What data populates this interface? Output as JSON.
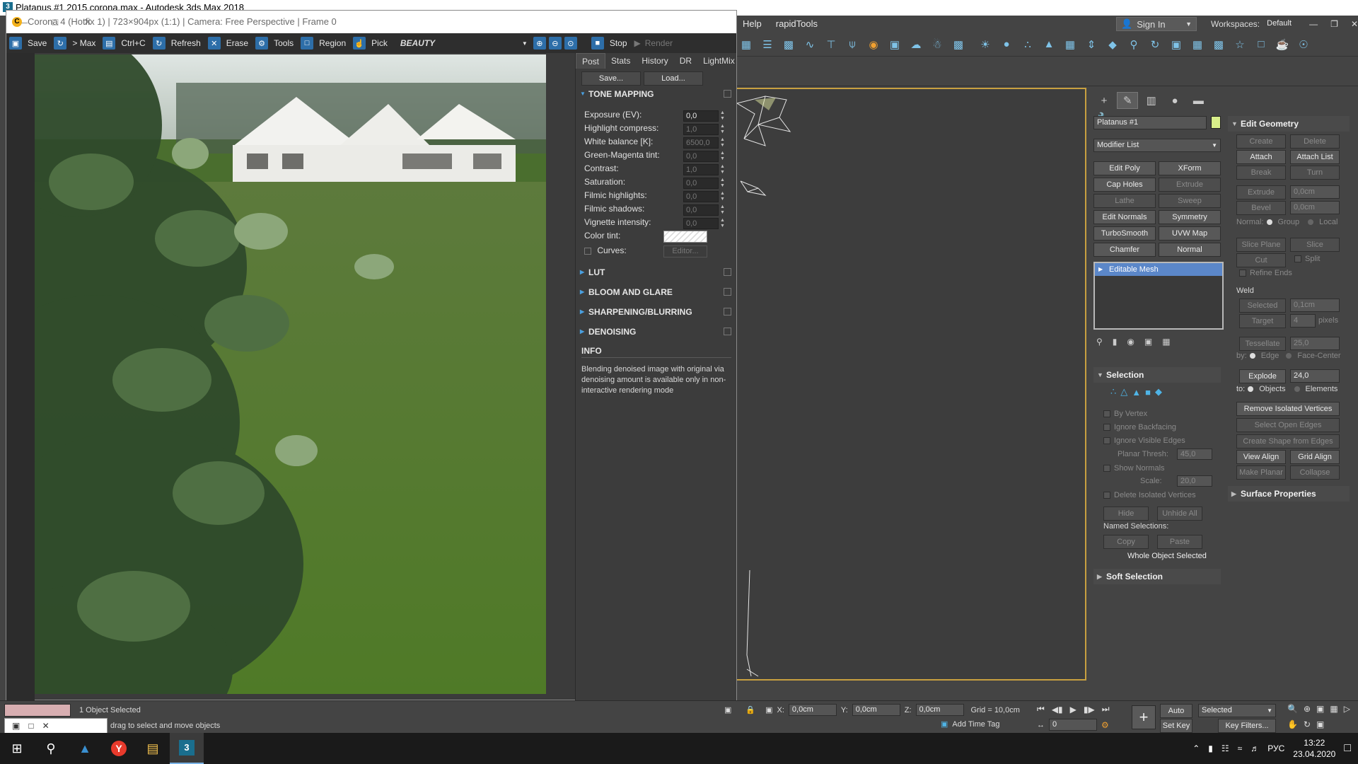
{
  "max_window": {
    "title": "Platanus #1 2015 corona.max - Autodesk 3ds Max 2018",
    "win_buttons": [
      "—",
      "□",
      "✕"
    ]
  },
  "menubar": {
    "items": [
      "Help",
      "rapidTools"
    ],
    "signin": "Sign In",
    "workspaces_label": "Workspaces:",
    "workspaces_value": "Default"
  },
  "vfb": {
    "title": "Corona 4 (Hotfix 1) | 723×904px (1:1) | Camera: Free Perspective | Frame 0",
    "win_buttons": [
      "—",
      "□",
      "✕"
    ],
    "toolbar": [
      {
        "icon": "save-icon",
        "label": "Save"
      },
      {
        "icon": "to-max-icon",
        "label": "> Max"
      },
      {
        "icon": "copy-icon",
        "label": "Ctrl+C"
      },
      {
        "icon": "refresh-icon",
        "label": "Refresh"
      },
      {
        "icon": "erase-icon",
        "label": "Erase"
      },
      {
        "icon": "tools-icon",
        "label": "Tools"
      },
      {
        "icon": "region-icon",
        "label": "Region"
      },
      {
        "icon": "pick-icon",
        "label": "Pick"
      }
    ],
    "channel": "BEAUTY",
    "stop_label": "Stop",
    "render_label": "Render",
    "post_tabs": [
      "Post",
      "Stats",
      "History",
      "DR",
      "LightMix"
    ],
    "save_btn": "Save...",
    "load_btn": "Load...",
    "tone_mapping": {
      "header": "TONE MAPPING",
      "rows": [
        {
          "label": "Exposure (EV):",
          "value": "0,0"
        },
        {
          "label": "Highlight compress:",
          "value": "1,0"
        },
        {
          "label": "White balance [K]:",
          "value": "6500,0"
        },
        {
          "label": "Green-Magenta tint:",
          "value": "0,0"
        },
        {
          "label": "Contrast:",
          "value": "1,0"
        },
        {
          "label": "Saturation:",
          "value": "0,0"
        },
        {
          "label": "Filmic highlights:",
          "value": "0,0"
        },
        {
          "label": "Filmic shadows:",
          "value": "0,0"
        },
        {
          "label": "Vignette intensity:",
          "value": "0,0"
        }
      ],
      "color_tint_label": "Color tint:",
      "curves_label": "Curves:",
      "curves_btn": "Editor..."
    },
    "sections": [
      "LUT",
      "BLOOM AND GLARE",
      "SHARPENING/BLURRING",
      "DENOISING"
    ],
    "info_header": "INFO",
    "info_text": "Blending denoised image with original via denoising amount is available only in non-interactive rendering mode"
  },
  "cmd_panel": {
    "object_name": "Platanus #1",
    "object_color": "#d8ee8a",
    "modifier_list": "Modifier List",
    "modifier_buttons": [
      {
        "label": "Edit Poly",
        "enabled": true
      },
      {
        "label": "XForm",
        "enabled": true
      },
      {
        "label": "Cap Holes",
        "enabled": true
      },
      {
        "label": "Extrude",
        "enabled": false
      },
      {
        "label": "Lathe",
        "enabled": false
      },
      {
        "label": "Sweep",
        "enabled": false
      },
      {
        "label": "Edit Normals",
        "enabled": true
      },
      {
        "label": "Symmetry",
        "enabled": true
      },
      {
        "label": "TurboSmooth",
        "enabled": true
      },
      {
        "label": "UVW Map",
        "enabled": true
      },
      {
        "label": "Chamfer",
        "enabled": true
      },
      {
        "label": "Normal",
        "enabled": true
      }
    ],
    "stack_item": "Editable Mesh",
    "selection": {
      "header": "Selection",
      "by_vertex": "By Vertex",
      "ignore_backfacing": "Ignore Backfacing",
      "ignore_visible_edges": "Ignore Visible Edges",
      "planar_thresh_label": "Planar Thresh:",
      "planar_thresh": "45,0",
      "show_normals": "Show Normals",
      "scale_label": "Scale:",
      "scale": "20,0",
      "delete_isolated": "Delete Isolated Vertices",
      "hide": "Hide",
      "unhide_all": "Unhide All",
      "named_selections": "Named Selections:",
      "copy": "Copy",
      "paste": "Paste",
      "status": "Whole Object Selected"
    },
    "soft_selection": "Soft Selection",
    "edit_geometry": {
      "header": "Edit Geometry",
      "create": "Create",
      "delete": "Delete",
      "attach": "Attach",
      "attach_list": "Attach List",
      "break": "Break",
      "turn": "Turn",
      "extrude": "Extrude",
      "extrude_val": "0,0cm",
      "bevel": "Bevel",
      "bevel_val": "0,0cm",
      "normal_label": "Normal:",
      "group": "Group",
      "local": "Local",
      "slice_plane": "Slice Plane",
      "slice": "Slice",
      "cut": "Cut",
      "split": "Split",
      "refine_ends": "Refine Ends",
      "weld": "Weld",
      "selected": "Selected",
      "selected_val": "0,1cm",
      "target": "Target",
      "target_val": "4",
      "pixels": "pixels",
      "tessellate": "Tessellate",
      "tessellate_val": "25,0",
      "by_label": "by:",
      "edge": "Edge",
      "face_center": "Face-Center",
      "explode": "Explode",
      "explode_val": "24,0",
      "to_label": "to:",
      "objects": "Objects",
      "elements": "Elements",
      "remove_isolated": "Remove Isolated Vertices",
      "select_open_edges": "Select Open Edges",
      "create_shape": "Create Shape from Edges",
      "view_align": "View Align",
      "grid_align": "Grid Align",
      "make_planar": "Make Planar",
      "collapse": "Collapse"
    },
    "surface_properties": "Surface Properties"
  },
  "status": {
    "selected": "1 Object Selected",
    "prompt": "drag to select and move objects",
    "x_label": "X:",
    "x": "0,0cm",
    "y_label": "Y:",
    "y": "0,0cm",
    "z_label": "Z:",
    "z": "0,0cm",
    "grid": "Grid = 10,0cm",
    "add_time_tag": "Add Time Tag",
    "auto_key": "Auto Key",
    "set_key": "Set Key",
    "selected_dropdown": "Selected",
    "key_filters": "Key Filters...",
    "frame": "0"
  },
  "taskbar": {
    "lang": "РУС",
    "time": "13:22",
    "date": "23.04.2020"
  }
}
